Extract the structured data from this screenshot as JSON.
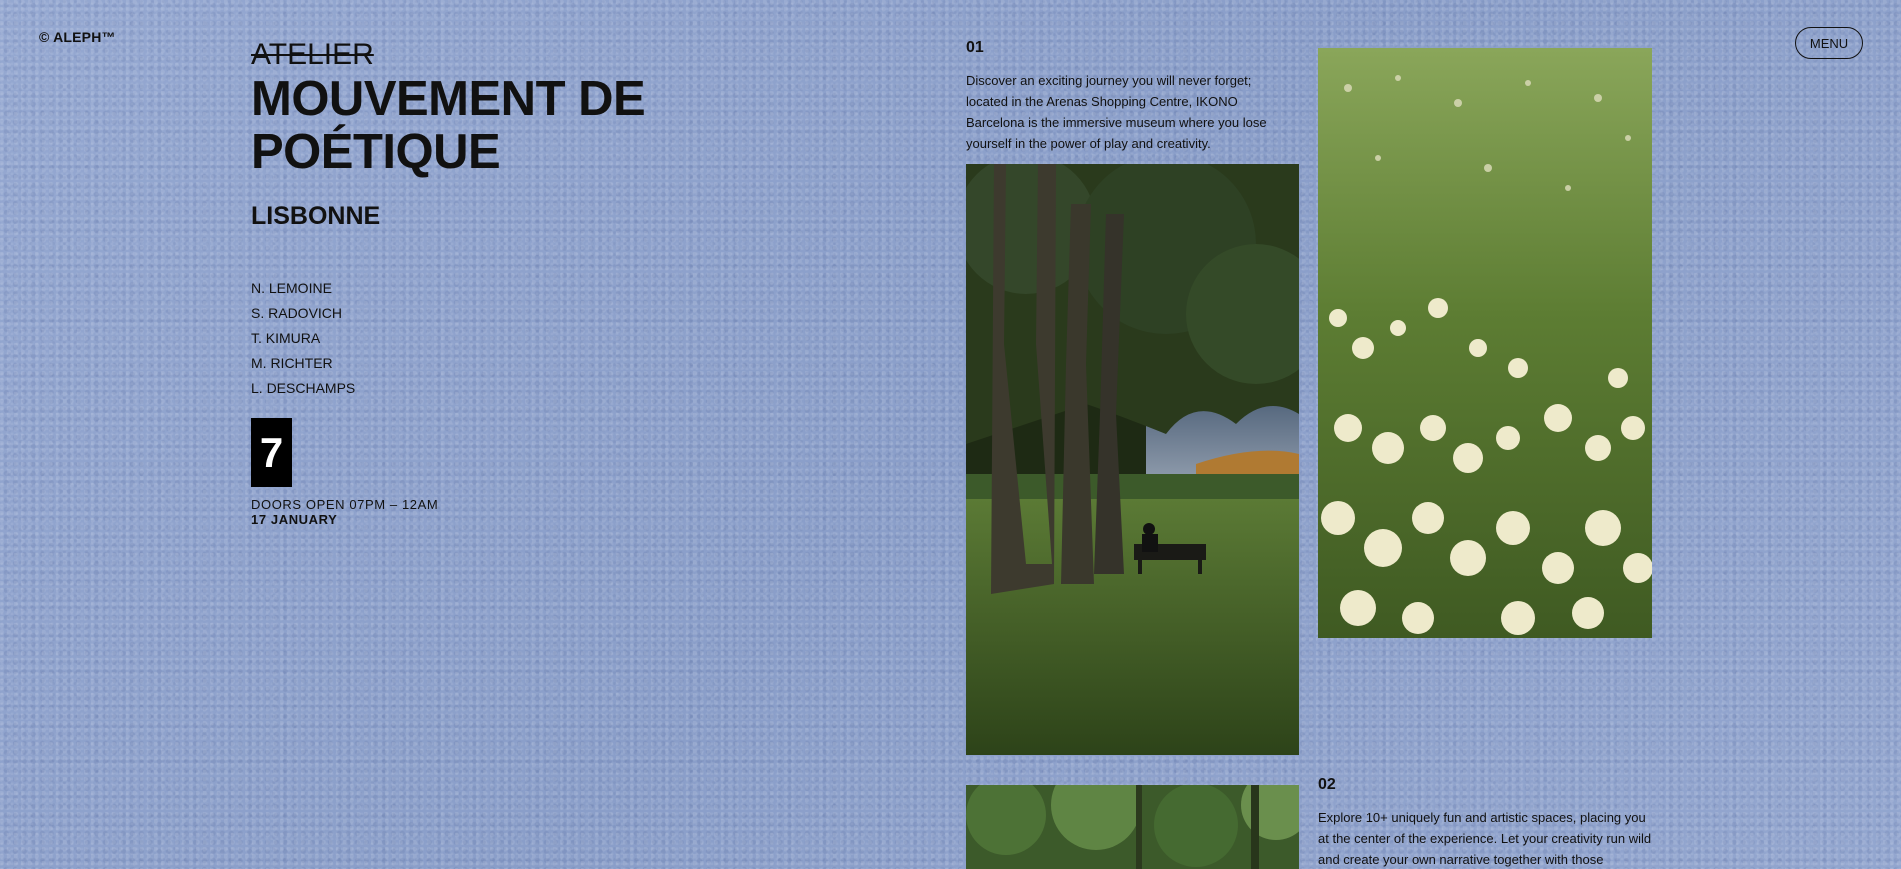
{
  "brand": {
    "copyright": "© ALEPH™"
  },
  "menu": {
    "label": "MENU"
  },
  "event": {
    "overline": "ATELIER",
    "title_line1": "MOUVEMENT DE",
    "title_line2": "POÉTIQUE",
    "city": "LISBONNE",
    "artists": [
      "N. LEMOINE",
      "S. RADOVICH",
      "T. KIMURA",
      "M. RICHTER",
      "L. DESCHAMPS"
    ],
    "day_number": "7",
    "doors": "DOORS OPEN 07PM – 12AM",
    "date": "17 JANUARY"
  },
  "sections": [
    {
      "number": "01",
      "text": "Discover an exciting journey you will never forget; located in the Arenas Shopping Centre, IKONO Barcelona is the immersive museum where you lose yourself in the power of play and creativity."
    },
    {
      "number": "02",
      "text": "Explore 10+ uniquely fun and artistic spaces, placing you at the center of the experience. Let your creativity run wild and create your own narrative together with those"
    }
  ],
  "images": {
    "park": "park-with-bench-photo",
    "flowers": "wildflower-meadow-photo",
    "forest": "forest-photo"
  }
}
